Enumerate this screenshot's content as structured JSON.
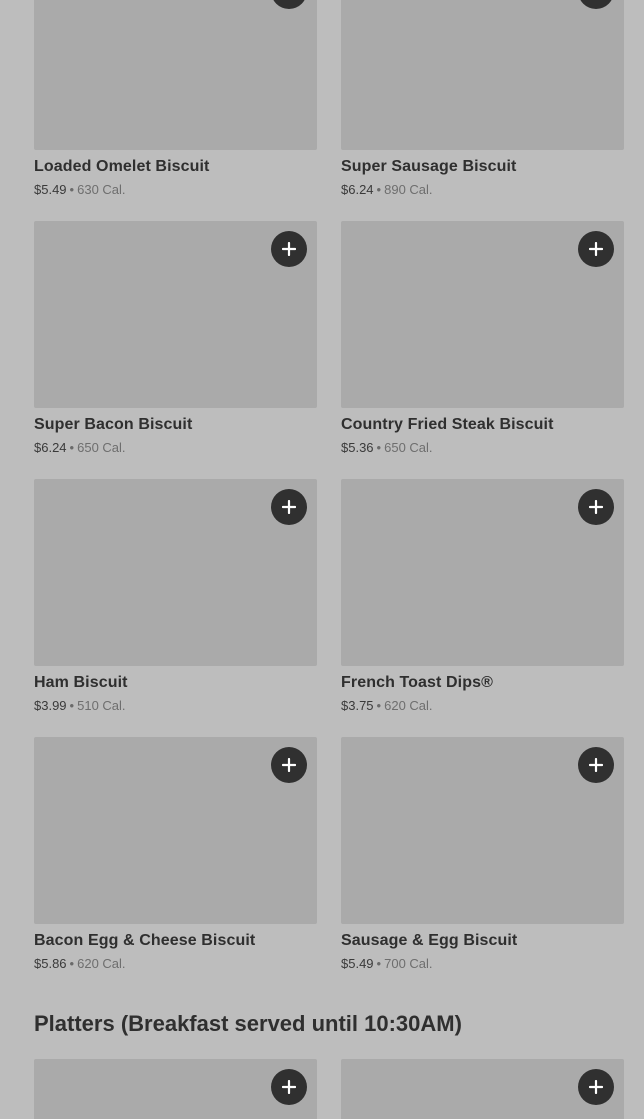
{
  "add_button_icon": "plus-icon",
  "colors": {
    "page_background": "#bdbdbd",
    "image_placeholder": "#aaaaaa",
    "add_button": "#303030",
    "add_icon": "#ffffff",
    "text_primary": "#2f2f2f",
    "text_secondary": "#6e6e6e"
  },
  "menu_items": [
    {
      "name": "Loaded Omelet Biscuit",
      "price": "$5.49",
      "calories": "630 Cal."
    },
    {
      "name": "Super Sausage Biscuit",
      "price": "$6.24",
      "calories": "890 Cal."
    },
    {
      "name": "Super Bacon Biscuit",
      "price": "$6.24",
      "calories": "650 Cal."
    },
    {
      "name": "Country Fried Steak Biscuit",
      "price": "$5.36",
      "calories": "650 Cal."
    },
    {
      "name": "Ham Biscuit",
      "price": "$3.99",
      "calories": "510 Cal."
    },
    {
      "name": "French Toast Dips®",
      "price": "$3.75",
      "calories": "620 Cal."
    },
    {
      "name": "Bacon Egg & Cheese Biscuit",
      "price": "$5.86",
      "calories": "620 Cal."
    },
    {
      "name": "Sausage & Egg Biscuit",
      "price": "$5.49",
      "calories": "700 Cal."
    }
  ],
  "separator": "•",
  "platters_section": {
    "title": "Platters (Breakfast served until 10:30AM)"
  }
}
